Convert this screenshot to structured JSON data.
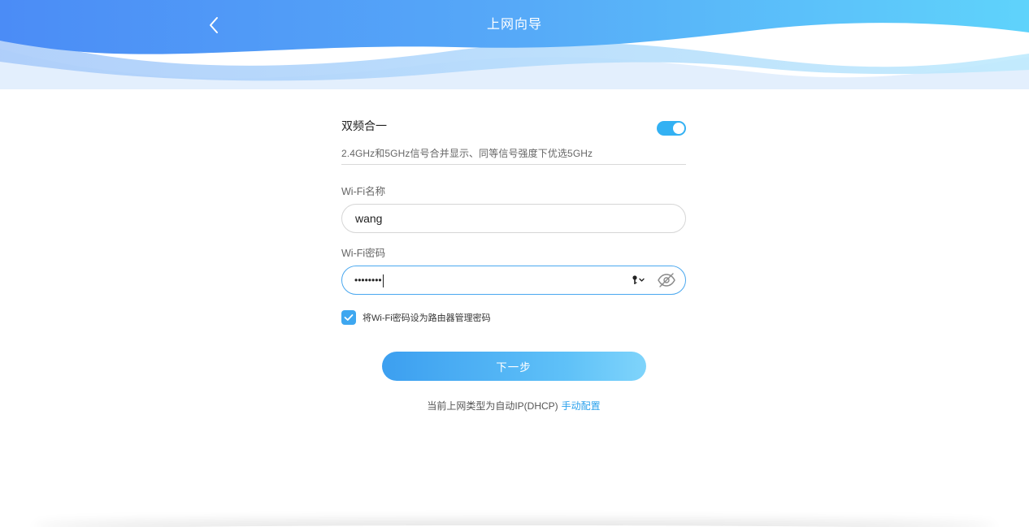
{
  "header": {
    "title": "上网向导",
    "back_icon": "chevron-left-icon"
  },
  "dual_band": {
    "label": "双频合一",
    "enabled": true,
    "description": "2.4GHz和5GHz信号合并显示、同等信号强度下优选5GHz"
  },
  "wifi_name": {
    "label": "Wi-Fi名称",
    "value": "wang"
  },
  "wifi_password": {
    "label": "Wi-Fi密码",
    "value_masked": "••••••••",
    "key_icon": "password-manager-key-icon",
    "eye_icon": "eye-hidden-icon"
  },
  "admin_password_option": {
    "checked": true,
    "label": "将Wi-Fi密码设为路由器管理密码"
  },
  "next_button": {
    "label": "下一步"
  },
  "footer": {
    "text": "当前上网类型为自动IP(DHCP)",
    "link": "手动配置"
  },
  "colors": {
    "accent": "#33b1f3",
    "link": "#2aa1ec",
    "header_gradient_start": "#4d8ff7",
    "header_gradient_end": "#5fd0fb"
  }
}
